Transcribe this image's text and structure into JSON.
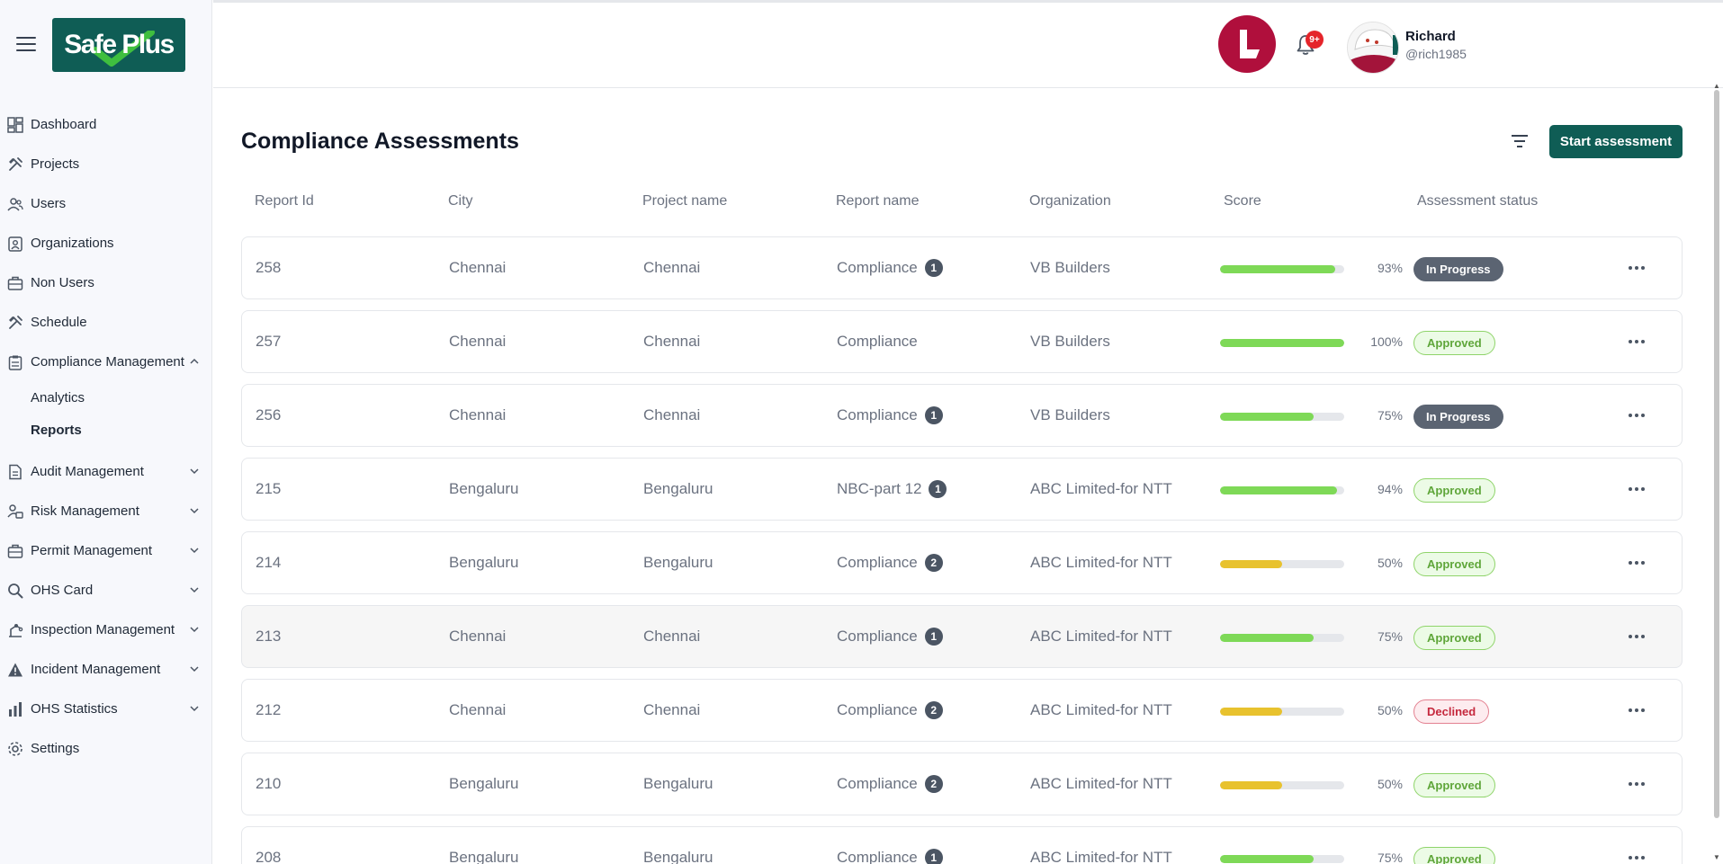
{
  "app": {
    "logo_text": "Safe Plus"
  },
  "sidebar": {
    "items": [
      {
        "label": "Dashboard",
        "icon": "dashboard-icon",
        "expandable": false
      },
      {
        "label": "Projects",
        "icon": "tools-icon",
        "expandable": false
      },
      {
        "label": "Users",
        "icon": "users-icon",
        "expandable": false
      },
      {
        "label": "Organizations",
        "icon": "organization-icon",
        "expandable": false
      },
      {
        "label": "Non Users",
        "icon": "briefcase-icon",
        "expandable": false
      },
      {
        "label": "Schedule",
        "icon": "tools-icon",
        "expandable": false
      },
      {
        "label": "Compliance Management",
        "icon": "clipboard-icon",
        "expandable": true,
        "expanded": true
      },
      {
        "label": "Audit Management",
        "icon": "document-icon",
        "expandable": true
      },
      {
        "label": "Risk Management",
        "icon": "risk-icon",
        "expandable": true
      },
      {
        "label": "Permit Management",
        "icon": "briefcase-icon",
        "expandable": true
      },
      {
        "label": "OHS Card",
        "icon": "search-icon",
        "expandable": true
      },
      {
        "label": "Inspection Management",
        "icon": "inspection-icon",
        "expandable": true
      },
      {
        "label": "Incident Management",
        "icon": "warning-icon",
        "expandable": true
      },
      {
        "label": "OHS Statistics",
        "icon": "bar-chart-icon",
        "expandable": true
      },
      {
        "label": "Settings",
        "icon": "gear-icon",
        "expandable": false
      }
    ],
    "compliance_sub": [
      {
        "label": "Analytics",
        "active": false
      },
      {
        "label": "Reports",
        "active": true
      }
    ]
  },
  "header": {
    "notification_count": "9+",
    "user_name": "Richard",
    "user_handle": "@rich1985"
  },
  "main": {
    "title": "Compliance Assessments",
    "start_button": "Start assessment",
    "columns": [
      "Report Id",
      "City",
      "Project name",
      "Report name",
      "Organization",
      "Score",
      "Assessment status"
    ],
    "rows": [
      {
        "id": "258",
        "city": "Chennai",
        "project": "Chennai",
        "report": "Compliance",
        "count": "1",
        "org": "VB Builders",
        "score": 93,
        "score_label": "93%",
        "status": "In Progress",
        "status_kind": "progress"
      },
      {
        "id": "257",
        "city": "Chennai",
        "project": "Chennai",
        "report": "Compliance",
        "count": "",
        "org": "VB Builders",
        "score": 100,
        "score_label": "100%",
        "status": "Approved",
        "status_kind": "approved"
      },
      {
        "id": "256",
        "city": "Chennai",
        "project": "Chennai",
        "report": "Compliance",
        "count": "1",
        "org": "VB Builders",
        "score": 75,
        "score_label": "75%",
        "status": "In Progress",
        "status_kind": "progress"
      },
      {
        "id": "215",
        "city": "Bengaluru",
        "project": "Bengaluru",
        "report": "NBC-part 12",
        "count": "1",
        "org": "ABC Limited-for NTT",
        "score": 94,
        "score_label": "94%",
        "status": "Approved",
        "status_kind": "approved"
      },
      {
        "id": "214",
        "city": "Bengaluru",
        "project": "Bengaluru",
        "report": "Compliance",
        "count": "2",
        "org": "ABC Limited-for NTT",
        "score": 50,
        "score_label": "50%",
        "status": "Approved",
        "status_kind": "approved"
      },
      {
        "id": "213",
        "city": "Chennai",
        "project": "Chennai",
        "report": "Compliance",
        "count": "1",
        "org": "ABC Limited-for NTT",
        "score": 75,
        "score_label": "75%",
        "status": "Approved",
        "status_kind": "approved"
      },
      {
        "id": "212",
        "city": "Chennai",
        "project": "Chennai",
        "report": "Compliance",
        "count": "2",
        "org": "ABC Limited-for NTT",
        "score": 50,
        "score_label": "50%",
        "status": "Declined",
        "status_kind": "declined"
      },
      {
        "id": "210",
        "city": "Bengaluru",
        "project": "Bengaluru",
        "report": "Compliance",
        "count": "2",
        "org": "ABC Limited-for NTT",
        "score": 50,
        "score_label": "50%",
        "status": "Approved",
        "status_kind": "approved"
      },
      {
        "id": "208",
        "city": "Bengaluru",
        "project": "Bengaluru",
        "report": "Compliance",
        "count": "1",
        "org": "ABC Limited-for NTT",
        "score": 75,
        "score_label": "75%",
        "status": "Approved",
        "status_kind": "approved"
      }
    ]
  },
  "colors": {
    "brand": "#0f5d55",
    "score_high": "#7ed957",
    "score_mid": "#e8c22e",
    "brand_circle": "#b00f3c"
  }
}
